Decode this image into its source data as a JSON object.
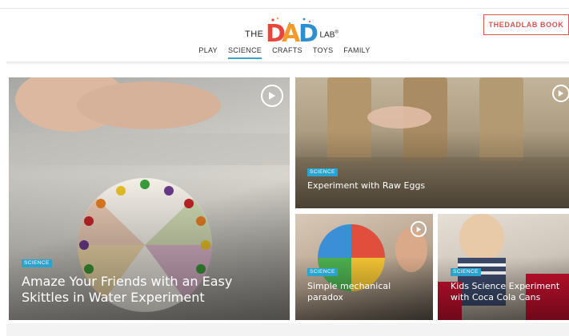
{
  "brand": {
    "the": "THE",
    "dad": "DAD",
    "lab": "LAB",
    "tm": "®",
    "colors": {
      "d1": "#e8453c",
      "a": "#f29a2e",
      "d2": "#2e8fd0"
    }
  },
  "header": {
    "book_button": "THEDADLAB BOOK",
    "nav": [
      {
        "label": "PLAY",
        "active": false
      },
      {
        "label": "SCIENCE",
        "active": true
      },
      {
        "label": "CRAFTS",
        "active": false
      },
      {
        "label": "TOYS",
        "active": false
      },
      {
        "label": "FAMILY",
        "active": false
      }
    ],
    "accent_color": "#3aa3c9",
    "button_color": "#d9534f"
  },
  "cards": [
    {
      "tag": "SCIENCE",
      "title": "Amaze Your Friends with an Easy Skittles in Water Experiment",
      "has_video": true
    },
    {
      "tag": "SCIENCE",
      "title": "Experiment with Raw Eggs",
      "has_video": true
    },
    {
      "tag": "SCIENCE",
      "title": "Simple mechanical paradox",
      "has_video": true
    },
    {
      "tag": "SCIENCE",
      "title": "Kids Science Experiment with Coca Cola Cans",
      "has_video": false
    }
  ],
  "tag_color": "#2aa3cf",
  "icons": {
    "play": "play-circle-icon"
  }
}
